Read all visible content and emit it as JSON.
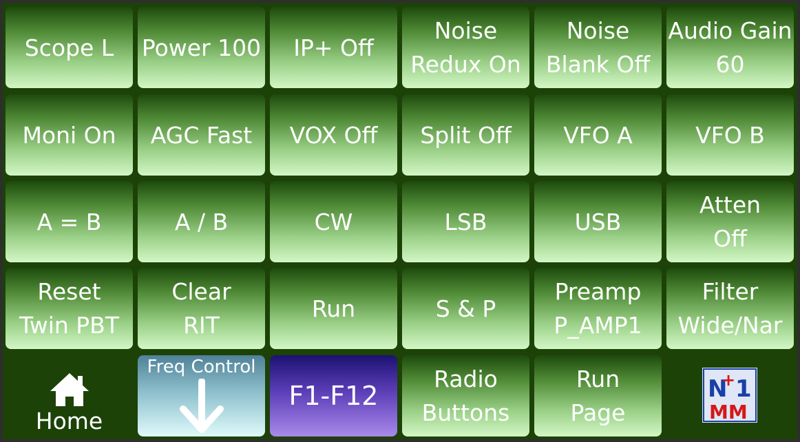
{
  "grid": [
    [
      [
        "Scope L"
      ],
      [
        "Power 100"
      ],
      [
        "IP+ Off"
      ],
      [
        "Noise",
        "Redux On"
      ],
      [
        "Noise",
        "Blank Off"
      ],
      [
        "Audio Gain",
        "60"
      ]
    ],
    [
      [
        "Moni On"
      ],
      [
        "AGC Fast"
      ],
      [
        "VOX Off"
      ],
      [
        "Split Off"
      ],
      [
        "VFO A"
      ],
      [
        "VFO B"
      ]
    ],
    [
      [
        "A = B"
      ],
      [
        "A / B"
      ],
      [
        "CW"
      ],
      [
        "LSB"
      ],
      [
        "USB"
      ],
      [
        "Atten",
        "Off"
      ]
    ],
    [
      [
        "Reset",
        "Twin PBT"
      ],
      [
        "Clear",
        "RIT"
      ],
      [
        "Run"
      ],
      [
        "S & P"
      ],
      [
        "Preamp",
        "P_AMP1"
      ],
      [
        "Filter",
        "Wide/Nar"
      ]
    ]
  ],
  "bottom": {
    "home_label": "Home",
    "home_icon": "home-icon",
    "freq_label": "Freq Control",
    "freq_icon": "arrow-down-icon",
    "fkeys_label": "F1-F12",
    "radio_buttons": [
      "Radio",
      "Buttons"
    ],
    "run_page": [
      "Run",
      "Page"
    ],
    "logo_icon": "n1mm-logo-icon",
    "logo_text": {
      "top": "N",
      "plus": "+",
      "one": "1",
      "bottom": "MM"
    }
  },
  "colors": {
    "background": "#1c4208",
    "button_top": "#1d4a0d",
    "button_bottom": "#d3f7c6",
    "freq_gradient_bottom": "#dffafa",
    "fkeys_gradient_top": "#1c1272",
    "fkeys_gradient_bottom": "#a989ea",
    "logo_red": "#d41818",
    "logo_blue": "#1a3fa6"
  }
}
